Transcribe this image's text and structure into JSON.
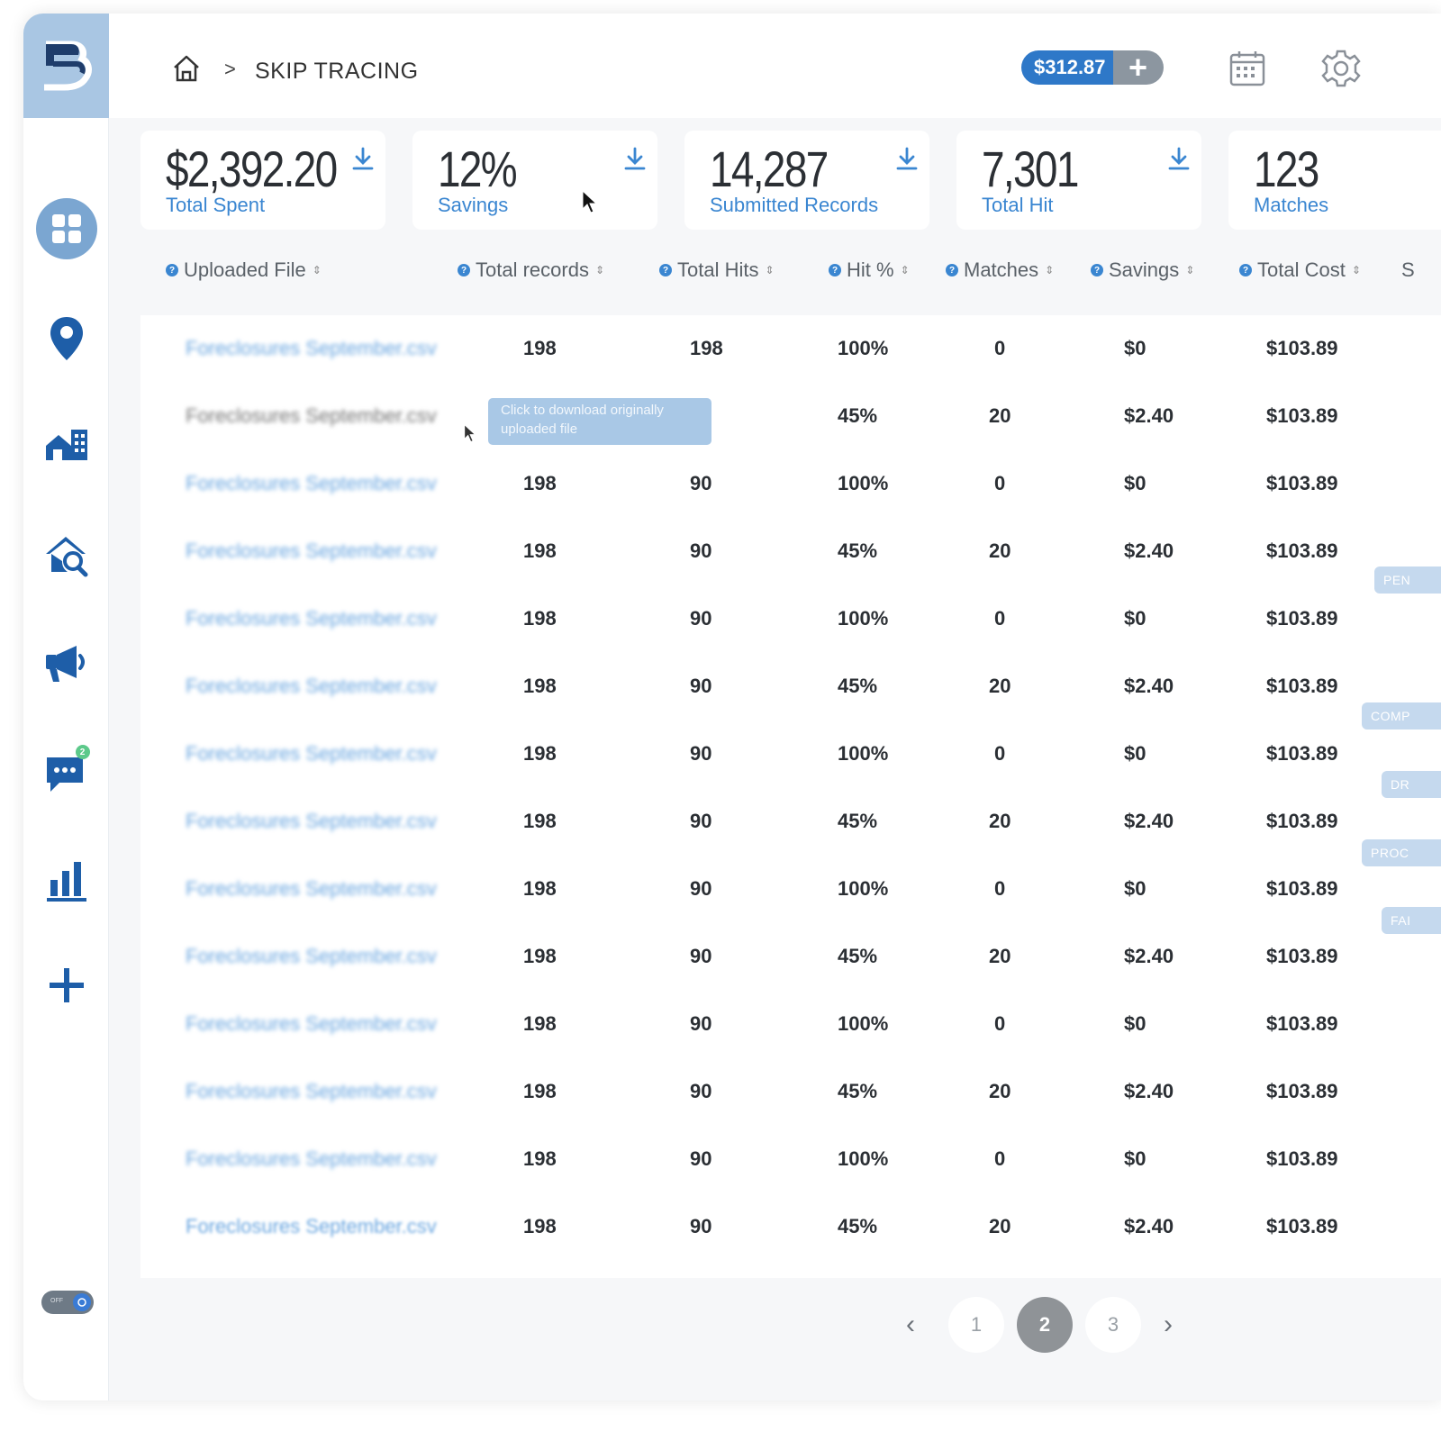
{
  "header": {
    "breadcrumb_separator": ">",
    "title": "SKIP TRACING",
    "balance": "$312.87",
    "balance_add": "+"
  },
  "sidebar": {
    "items": [
      {
        "name": "dashboard",
        "icon": "dashboard-grid-icon",
        "active": true
      },
      {
        "name": "map",
        "icon": "map-pin-icon"
      },
      {
        "name": "properties",
        "icon": "buildings-icon"
      },
      {
        "name": "property-search",
        "icon": "house-search-icon"
      },
      {
        "name": "marketing",
        "icon": "megaphone-icon"
      },
      {
        "name": "messages",
        "icon": "chat-icon",
        "badge": "2"
      },
      {
        "name": "reports",
        "icon": "bar-chart-icon"
      },
      {
        "name": "add",
        "icon": "plus-icon"
      }
    ],
    "toggle_label": "OFF"
  },
  "stats": [
    {
      "value": "$2,392.20",
      "label": "Total Spent"
    },
    {
      "value": "12%",
      "label": "Savings"
    },
    {
      "value": "14,287",
      "label": "Submitted Records"
    },
    {
      "value": "7,301",
      "label": "Total Hit"
    },
    {
      "value": "123",
      "label": "Matches"
    }
  ],
  "table": {
    "columns": [
      "Uploaded File",
      "Total records",
      "Total Hits",
      "Hit %",
      "Matches",
      "Savings",
      "Total Cost",
      "S"
    ],
    "rows": [
      [
        "Foreclosures September.csv",
        "198",
        "198",
        "100%",
        "0",
        "$0",
        "$103.89"
      ],
      [
        "Foreclosures September.csv",
        "",
        "",
        "45%",
        "20",
        "$2.40",
        "$103.89"
      ],
      [
        "Foreclosures September.csv",
        "198",
        "90",
        "100%",
        "0",
        "$0",
        "$103.89"
      ],
      [
        "Foreclosures September.csv",
        "198",
        "90",
        "45%",
        "20",
        "$2.40",
        "$103.89"
      ],
      [
        "Foreclosures September.csv",
        "198",
        "90",
        "100%",
        "0",
        "$0",
        "$103.89"
      ],
      [
        "Foreclosures September.csv",
        "198",
        "90",
        "45%",
        "20",
        "$2.40",
        "$103.89"
      ],
      [
        "Foreclosures September.csv",
        "198",
        "90",
        "100%",
        "0",
        "$0",
        "$103.89"
      ],
      [
        "Foreclosures September.csv",
        "198",
        "90",
        "45%",
        "20",
        "$2.40",
        "$103.89"
      ],
      [
        "Foreclosures September.csv",
        "198",
        "90",
        "100%",
        "0",
        "$0",
        "$103.89"
      ],
      [
        "Foreclosures September.csv",
        "198",
        "90",
        "45%",
        "20",
        "$2.40",
        "$103.89"
      ],
      [
        "Foreclosures September.csv",
        "198",
        "90",
        "100%",
        "0",
        "$0",
        "$103.89"
      ],
      [
        "Foreclosures September.csv",
        "198",
        "90",
        "45%",
        "20",
        "$2.40",
        "$103.89"
      ],
      [
        "Foreclosures September.csv",
        "198",
        "90",
        "100%",
        "0",
        "$0",
        "$103.89"
      ],
      [
        "Foreclosures September.csv",
        "198",
        "90",
        "45%",
        "20",
        "$2.40",
        "$103.89"
      ]
    ],
    "status_pills": [
      "PEN",
      "COMP",
      "DR",
      "PROC",
      "FAI"
    ],
    "tooltip": "Click to download originally uploaded file"
  },
  "pagination": {
    "prev": "‹",
    "next": "›",
    "pages": [
      "1",
      "2",
      "3"
    ],
    "current": "2"
  },
  "colors": {
    "accent": "#3a86d1",
    "logo_bg": "#a9c6e3",
    "balance_bg": "#2e78c8",
    "active_page": "#8f9397"
  }
}
